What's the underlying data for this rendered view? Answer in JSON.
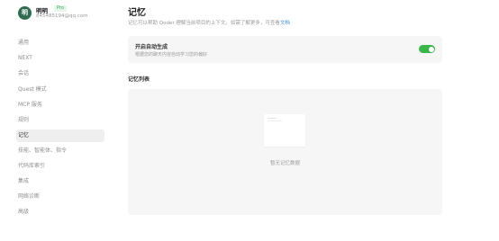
{
  "profile": {
    "avatar_letter": "明",
    "name": "明明",
    "badge": "Pro",
    "email": "845485194@qq.com"
  },
  "sidebar": {
    "items": [
      {
        "label": "通用",
        "active": false
      },
      {
        "label": "NEXT",
        "active": false
      },
      {
        "label": "会话",
        "active": false
      },
      {
        "label": "Quest 模式",
        "active": false
      },
      {
        "label": "MCP 服务",
        "active": false
      },
      {
        "label": "规则",
        "active": false
      },
      {
        "label": "记忆",
        "active": true
      },
      {
        "label": "技能、智能体、指令",
        "active": false
      },
      {
        "label": "代码库索引",
        "active": false
      },
      {
        "label": "集成",
        "active": false
      },
      {
        "label": "网络诊断",
        "active": false
      },
      {
        "label": "高级",
        "active": false
      }
    ]
  },
  "main": {
    "title": "记忆",
    "description": "记忆可以帮助 Qoder 理解当前项目的上下文。如需了解更多，可查看",
    "description_link": "文档",
    "auto_generate": {
      "title": "开启自动生成",
      "description": "根据您的聊天内容自动学习您的偏好",
      "enabled": true
    },
    "list_title": "记忆列表",
    "empty_text": "暂无记忆数据"
  },
  "colors": {
    "accent": "#39b54a",
    "link": "#3c8fd9",
    "avatar_bg": "#2e6b4f"
  }
}
